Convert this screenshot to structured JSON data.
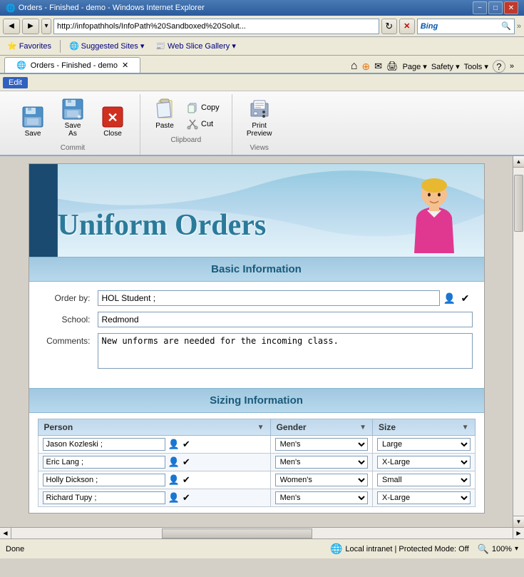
{
  "window": {
    "title": "Orders - Finished - demo - Windows Internet Explorer",
    "minimize_label": "−",
    "restore_label": "□",
    "close_label": "✕"
  },
  "address_bar": {
    "url": "http://infopathhols/InfoPath%20Sandboxed%20Solut...",
    "refresh_icon": "↻",
    "stop_icon": "✕",
    "go_icon": "→",
    "search_placeholder": "Bing"
  },
  "favorites_bar": {
    "favorites_label": "Favorites",
    "suggested_sites_label": "Suggested Sites ▾",
    "web_slice_gallery_label": "Web Slice Gallery ▾"
  },
  "tab": {
    "label": "Orders - Finished - demo",
    "close_icon": "✕"
  },
  "ie_toolbar": {
    "home_icon": "⌂",
    "feeds_icon": "⊕",
    "mail_icon": "✉",
    "print_icon": "🖨",
    "page_label": "Page ▾",
    "safety_label": "Safety ▾",
    "tools_label": "Tools ▾",
    "help_icon": "?",
    "extend_icon": "»"
  },
  "ribbon": {
    "menu_items": [
      "Edit"
    ],
    "groups": [
      {
        "name": "Commit",
        "buttons_large": [
          {
            "id": "save",
            "label": "Save"
          },
          {
            "id": "save-as",
            "label": "Save As"
          },
          {
            "id": "close",
            "label": "Close"
          }
        ]
      },
      {
        "name": "Clipboard",
        "buttons_small": [
          {
            "id": "paste",
            "label": "Paste"
          }
        ],
        "buttons_mini": [
          {
            "id": "copy",
            "label": "Copy"
          },
          {
            "id": "cut",
            "label": "Cut"
          }
        ]
      },
      {
        "name": "Views",
        "buttons_large": [
          {
            "id": "print-preview",
            "label": "Print Preview"
          }
        ]
      }
    ]
  },
  "form": {
    "title": "Uniform Orders",
    "sections": [
      {
        "id": "basic-info",
        "title": "Basic Information",
        "fields": [
          {
            "label": "Order by:",
            "type": "text-with-picker",
            "value": "HOL Student ;"
          },
          {
            "label": "School:",
            "type": "text",
            "value": "Redmond"
          },
          {
            "label": "Comments:",
            "type": "textarea",
            "value": "New unforms are needed for the incoming class."
          }
        ]
      },
      {
        "id": "sizing-info",
        "title": "Sizing Information",
        "table": {
          "columns": [
            "Person",
            "Gender",
            "Size"
          ],
          "rows": [
            {
              "person": "Jason Kozleski ;",
              "gender": "Men's",
              "size": "Large"
            },
            {
              "person": "Eric Lang ;",
              "gender": "Men's",
              "size": "X-Large"
            },
            {
              "person": "Holly Dickson ;",
              "gender": "Women's",
              "size": "Small"
            },
            {
              "person": "Richard Tupy ;",
              "gender": "Men's",
              "size": "X-Large"
            }
          ]
        }
      }
    ]
  },
  "status_bar": {
    "done_label": "Done",
    "zone_label": "Local intranet | Protected Mode: Off",
    "zoom_label": "100%"
  }
}
